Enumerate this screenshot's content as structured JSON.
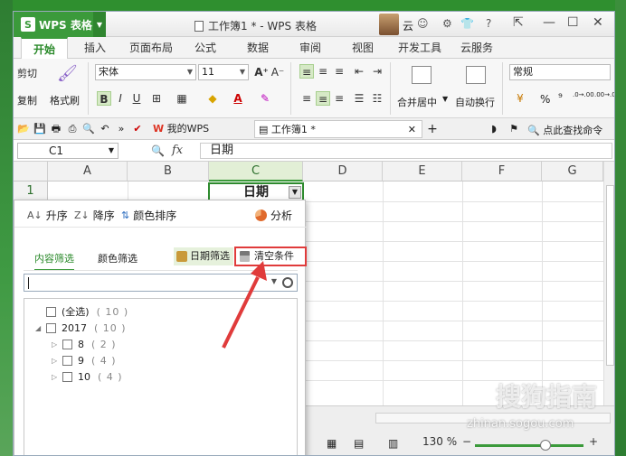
{
  "titlebar": {
    "app_name": "WPS 表格",
    "doc_title": "工作簿1 * - WPS 表格",
    "user": "云"
  },
  "menu_tabs": [
    "开始",
    "插入",
    "页面布局",
    "公式",
    "数据",
    "审阅",
    "视图",
    "开发工具",
    "云服务"
  ],
  "ribbon": {
    "cut": "剪切",
    "copy": "复制",
    "format_painter": "格式刷",
    "font_name": "宋体",
    "font_size": "11",
    "merge_center": "合并居中",
    "wrap_text": "自动换行",
    "number_format": "常规",
    "percent": "%",
    "comma": "⁹",
    "dec_inc": ".0→.00",
    "dec_dec": ".00→.0"
  },
  "quickbar": {
    "mywps_tab": "我的WPS",
    "workbook_tab": "工作簿1 *",
    "search_cmd": "点此查找命令"
  },
  "formula_bar": {
    "cell_ref": "C1",
    "fx": "fx",
    "value": "日期"
  },
  "columns": [
    "A",
    "B",
    "C",
    "D",
    "E",
    "F",
    "G"
  ],
  "rows": [
    "1"
  ],
  "cell_c1": "日期",
  "filter_popup": {
    "sort_asc": "升序",
    "sort_desc": "降序",
    "color_sort": "颜色排序",
    "analyze": "分析",
    "tab_content": "内容筛选",
    "tab_color": "颜色筛选",
    "date_filter": "日期筛选",
    "clear_conditions": "清空条件",
    "search_placeholder": "",
    "items": [
      {
        "label": "(全选)",
        "count": "( 10 )",
        "level": 0,
        "expander": ""
      },
      {
        "label": "2017",
        "count": "( 10 )",
        "level": 0,
        "expander": "◢"
      },
      {
        "label": "8",
        "count": "( 2 )",
        "level": 1,
        "expander": "▷"
      },
      {
        "label": "9",
        "count": "( 4 )",
        "level": 1,
        "expander": "▷"
      },
      {
        "label": "10",
        "count": "( 4 )",
        "level": 1,
        "expander": "▷"
      }
    ]
  },
  "statusbar": {
    "zoom": "130 %",
    "zoom_minus": "−",
    "zoom_plus": "+",
    "zoom_level_percent": 130
  },
  "watermark": {
    "brand": "搜狗指南",
    "url": "zhinan.sogou.com"
  },
  "colors": {
    "accent": "#3b9a3b",
    "highlight_border": "#e03b3b"
  }
}
